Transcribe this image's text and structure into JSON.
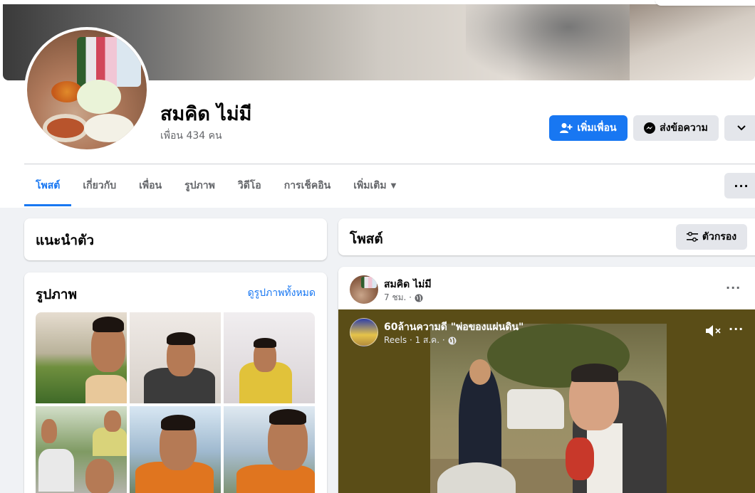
{
  "profile": {
    "name": "สมคิด ไม่มี",
    "friends_count": "เพื่อน 434 คน"
  },
  "actions": {
    "add_friend": "เพิ่มเพื่อน",
    "message": "ส่งข้อความ"
  },
  "tabs": [
    {
      "label": "โพสต์",
      "active": true
    },
    {
      "label": "เกี่ยวกับ"
    },
    {
      "label": "เพื่อน"
    },
    {
      "label": "รูปภาพ"
    },
    {
      "label": "วิดีโอ"
    },
    {
      "label": "การเช็คอิน"
    },
    {
      "label": "เพิ่มเติม"
    }
  ],
  "intro": {
    "title": "แนะนำตัว"
  },
  "photos": {
    "title": "รูปภาพ",
    "see_all": "ดูรูปภาพทั้งหมด"
  },
  "posts": {
    "title": "โพสต์",
    "filter_label": "ตัวกรอง"
  },
  "post": {
    "author": "สมคิด ไม่มี",
    "time": "7 ชม. ·",
    "shared": {
      "title": "60ล้านความดี \"พ่อของแผ่นดิน\"",
      "meta": "Reels · 1 ส.ค. ·"
    }
  },
  "colors": {
    "primary": "#1877f2",
    "background": "#f0f2f5",
    "secondary_button": "#e4e6eb",
    "muted_text": "#65676b"
  }
}
